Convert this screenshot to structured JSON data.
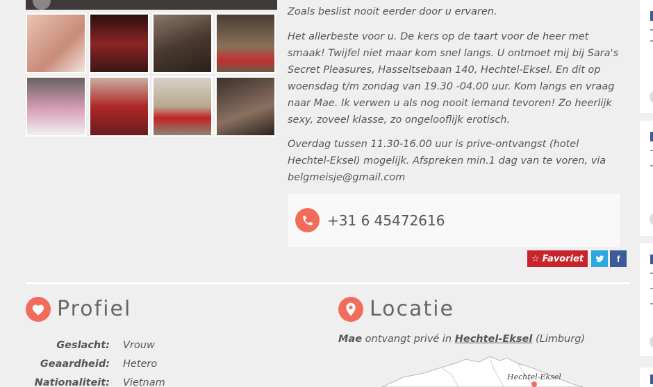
{
  "description": {
    "p0": "Zoals beslist nooit eerder door u ervaren.",
    "p1": "Het allerbeste voor u. De kers op de taart voor de heer met smaak! Twijfel niet maar kom snel langs. U ontmoet mij bij Sara's Secret Pleasures, Hasseltsebaan 140, Hechtel-Eksel. En dit op woensdag t/m zondag van 19.30 -04.00 uur. Kom langs en vraag naar Mae. Ik verwen u als nog nooit iemand tevoren! Zo heerlijk sexy, zoveel klasse, zo ongelooflijk erotisch.",
    "p2": "Overdag tussen 11.30-16.00 uur is prive-ontvangst (hotel Hechtel-Eksel) mogelijk. Afspreken min.1 dag van te voren, via belgmeisje@gmail.com"
  },
  "contact": {
    "phone": "+31 6 45472616"
  },
  "actions": {
    "favorite_label": "Favoriet",
    "twitter_icon": "twitter-icon",
    "facebook_icon": "facebook-icon"
  },
  "gallery": {
    "thumbs": [
      {
        "color": "#d9a594"
      },
      {
        "color": "#7a1f1f"
      },
      {
        "color": "#5b4a3f"
      },
      {
        "color": "#6e5a48"
      },
      {
        "color": "#8a7f87"
      },
      {
        "color": "#9b3a2e"
      },
      {
        "color": "#a49584"
      },
      {
        "color": "#4a3e38"
      }
    ]
  },
  "profile": {
    "title": "Profiel",
    "icon": "heart-icon",
    "rows": [
      {
        "label": "Geslacht:",
        "value": "Vrouw"
      },
      {
        "label": "Geaardheid:",
        "value": "Hetero"
      },
      {
        "label": "Nationaliteit:",
        "value": "Vietnam"
      }
    ]
  },
  "location": {
    "title": "Locatie",
    "icon": "map-pin-icon",
    "name": "Mae",
    "text_mid": " ontvangt privé in ",
    "city": "Hechtel-Eksel",
    "region": " (Limburg)",
    "map_label": "Hechtel-Eksel"
  },
  "colors": {
    "accent": "#f26c5c",
    "favorite": "#c9242b",
    "twitter": "#2ca7e0",
    "facebook": "#3b5b99"
  }
}
